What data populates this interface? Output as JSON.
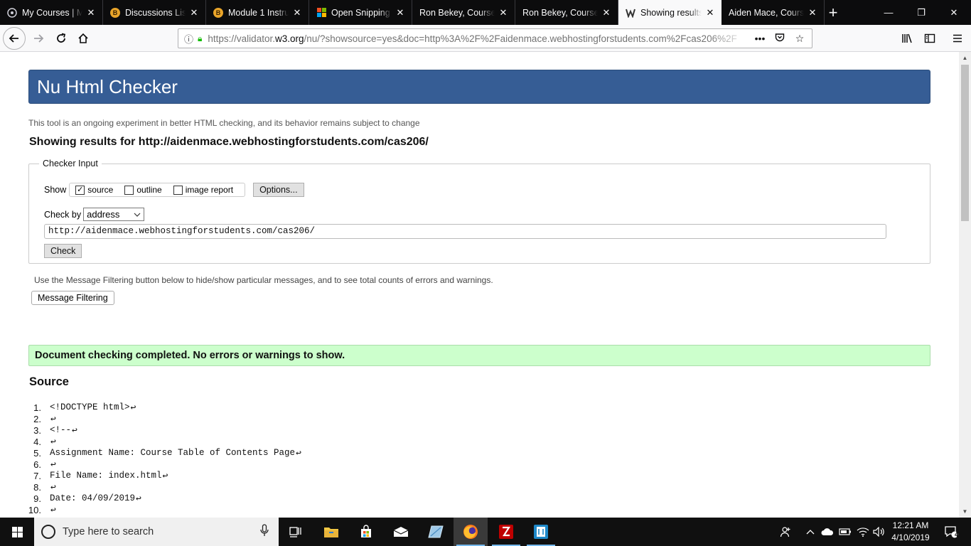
{
  "browser": {
    "tabs": [
      {
        "label": "My Courses | M",
        "icon": "canvas-icon"
      },
      {
        "label": "Discussions List",
        "icon": "blackboard-icon"
      },
      {
        "label": "Module 1 Instru",
        "icon": "blackboard-icon"
      },
      {
        "label": "Open Snipping",
        "icon": "microsoft-icon"
      },
      {
        "label": "Ron Bekey, Course T",
        "icon": "none"
      },
      {
        "label": "Ron Bekey, Course T",
        "icon": "none"
      },
      {
        "label": "Showing results",
        "icon": "w3c-validator-icon"
      },
      {
        "label": "Aiden Mace, Course",
        "icon": "none"
      }
    ],
    "active_tab_index": 6,
    "url": {
      "prefix": "https://validator.",
      "domain": "w3.org",
      "rest": "/nu/?showsource=yes&doc=http%3A%2F%2Faidenmace.webhostingforstudents.com%2Fcas206%2F"
    }
  },
  "page": {
    "header_title": "Nu Html Checker",
    "tagline": "This tool is an ongoing experiment in better HTML checking, and its behavior remains subject to change",
    "showing_results": "Showing results for http://aidenmace.webhostingforstudents.com/cas206/",
    "checker_input": {
      "legend": "Checker Input",
      "show_label": "Show",
      "options": [
        {
          "label": "source",
          "checked": true
        },
        {
          "label": "outline",
          "checked": false
        },
        {
          "label": "image report",
          "checked": false
        }
      ],
      "options_button": "Options...",
      "check_by_label": "Check by",
      "check_by_value": "address",
      "address_value": "http://aidenmace.webhostingforstudents.com/cas206/",
      "check_button": "Check"
    },
    "filter_note": "Use the Message Filtering button below to hide/show particular messages, and to see total counts of errors and warnings.",
    "filter_button": "Message Filtering",
    "success_message": "Document checking completed. No errors or warnings to show.",
    "source_title": "Source",
    "source_lines": [
      {
        "n": "1.",
        "text": "<!DOCTYPE html>"
      },
      {
        "n": "2.",
        "text": ""
      },
      {
        "n": "3.",
        "text": "<!--"
      },
      {
        "n": "4.",
        "text": ""
      },
      {
        "n": "5.",
        "text": "Assignment Name: Course Table of Contents Page"
      },
      {
        "n": "6.",
        "text": ""
      },
      {
        "n": "7.",
        "text": "File Name: index.html"
      },
      {
        "n": "8.",
        "text": ""
      },
      {
        "n": "9.",
        "text": "Date: 04/09/2019"
      },
      {
        "n": "10.",
        "text": ""
      }
    ]
  },
  "taskbar": {
    "search_placeholder": "Type here to search",
    "time": "12:21 AM",
    "date": "4/10/2019",
    "notification_count": "4"
  },
  "colors": {
    "header_blue": "#365d95",
    "success_green": "#ccffcc",
    "tab_dark": "#0c0c0d"
  }
}
